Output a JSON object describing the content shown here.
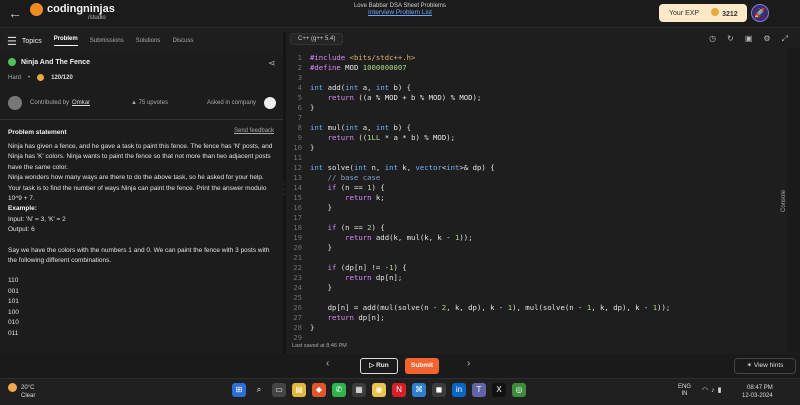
{
  "header": {
    "logo_text": "codingninjas",
    "logo_sub": "/studio",
    "sheet_title": "Love Babbar DSA Sheet Problems",
    "sheet_link": "Interview Problem List",
    "exp_label": "Your EXP",
    "exp_value": "3212"
  },
  "nav": {
    "topics": "Topics",
    "tabs": [
      "Problem",
      "Submissions",
      "Solutions",
      "Discuss"
    ]
  },
  "problem": {
    "title": "Ninja And The Fence",
    "difficulty": "Hard",
    "score": "120/120",
    "contributed_by": "Contributed by",
    "author": "Omkar",
    "upvotes": "75 upvotes",
    "asked_in": "Asked in company",
    "statement_heading": "Problem statement",
    "feedback": "Send feedback",
    "statement_lines": [
      "Ninja has given a fence, and he gave a task to paint this fence. The fence has 'N' posts, and Ninja has 'K' colors. Ninja wants to paint the fence so that not more than two adjacent posts have the same color.",
      "Ninja wonders how many ways are there to do the above task, so he asked for your help.",
      "Your task is to find the number of ways Ninja can paint the fence. Print the answer modulo 10^9 + 7."
    ],
    "example_label": "Example:",
    "example_input": "Input: 'N' = 3, 'K' = 2",
    "example_output": "Output: 6",
    "explanation": "Say we have the colors with the numbers 1 and 0. We can paint the fence with 3 posts with the following different combinations.",
    "combinations": [
      "110",
      "001",
      "101",
      "100",
      "010",
      "011"
    ]
  },
  "editor": {
    "language": "C++ (g++ 5.4)",
    "last_saved": "Last saved at 8:46 PM",
    "run_label": "Run",
    "submit_label": "Submit",
    "hints_label": "View hints",
    "console_label": "Console"
  },
  "code_lines": [
    "#include <bits/stdc++.h>",
    "#define MOD 1000000007",
    "",
    "int add(int a, int b) {",
    "    return ((a % MOD + b % MOD) % MOD);",
    "}",
    "",
    "int mul(int a, int b) {",
    "    return ((1LL * a * b) % MOD);",
    "}",
    "",
    "int solve(int n, int k, vector<int>& dp) {",
    "    // base case",
    "    if (n == 1) {",
    "        return k;",
    "    }",
    "",
    "    if (n == 2) {",
    "        return add(k, mul(k, k - 1));",
    "    }",
    "",
    "    if (dp[n] != -1) {",
    "        return dp[n];",
    "    }",
    "",
    "    dp[n] = add(mul(solve(n - 2, k, dp), k - 1), mul(solve(n - 1, k, dp), k - 1));",
    "    return dp[n];",
    "}",
    "",
    "int numberOfWays(int n, int k) {"
  ],
  "taskbar": {
    "temperature": "20°C",
    "weather": "Clear",
    "lang_top": "ENG",
    "lang_bottom": "IN",
    "time": "08:47 PM",
    "date": "12-03-2024"
  }
}
